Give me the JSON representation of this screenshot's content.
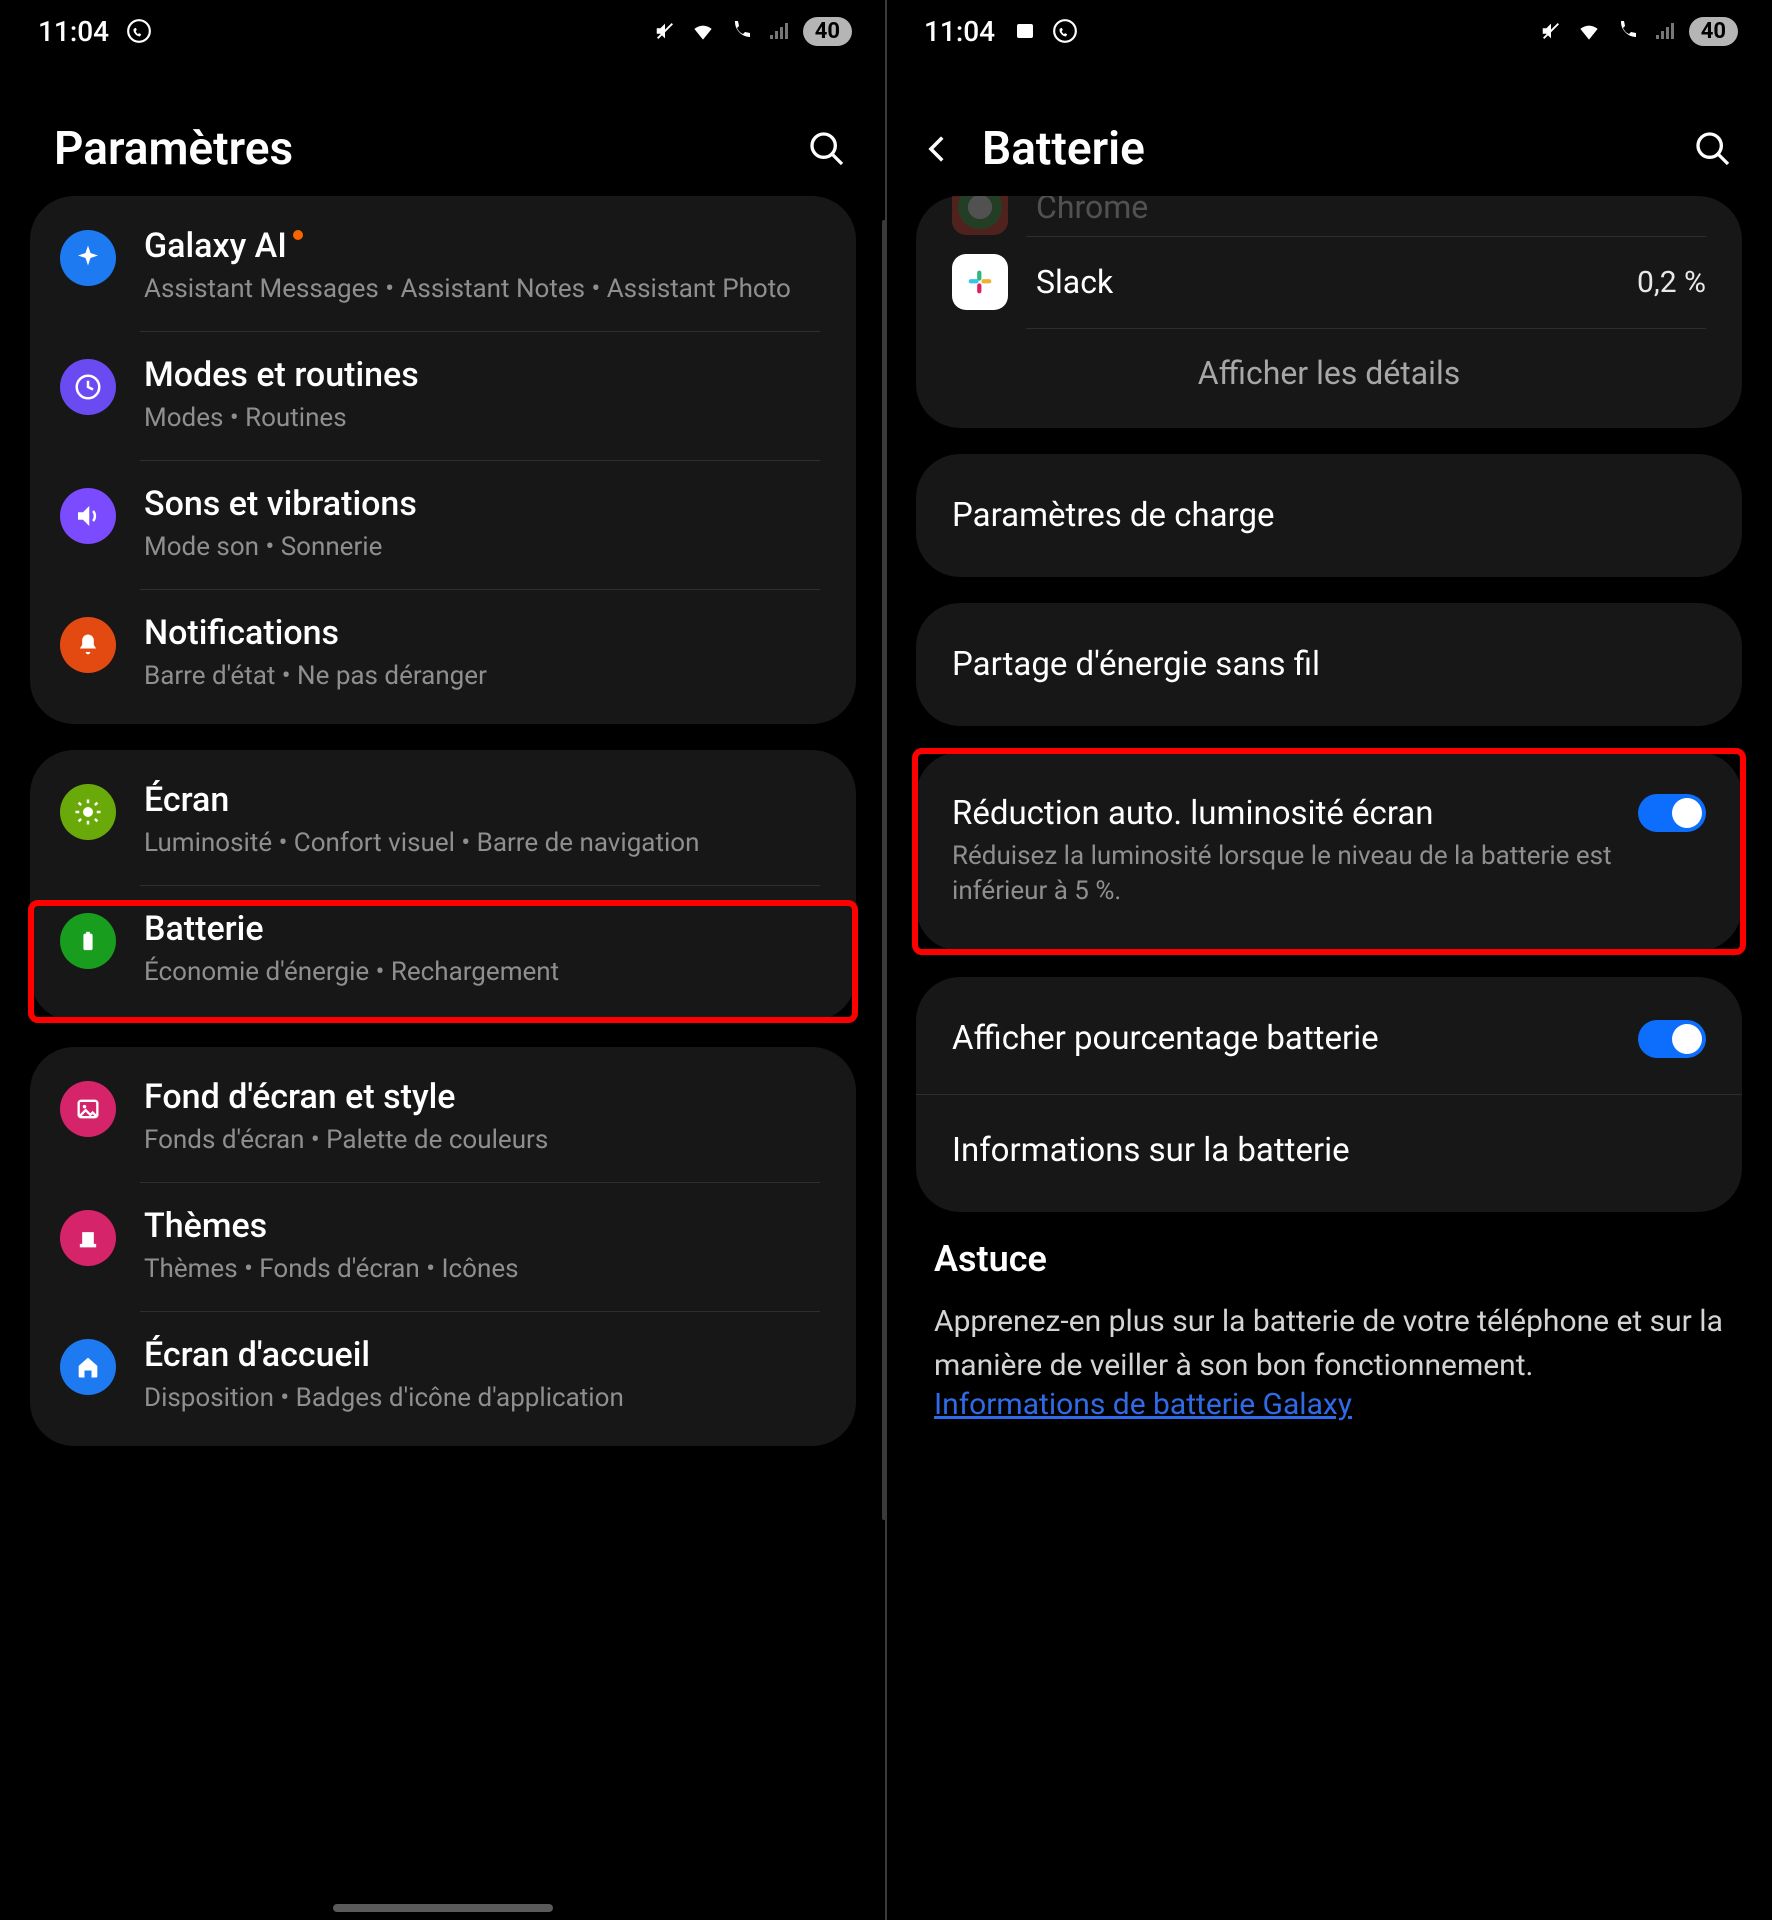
{
  "left": {
    "status": {
      "time": "11:04",
      "battery_pct": "40"
    },
    "title": "Paramètres",
    "groups": [
      {
        "items": [
          {
            "key": "galaxy-ai",
            "icon_bg": "#1d7af0",
            "title": "Galaxy AI",
            "badge": true,
            "sub": "Assistant Messages  •  Assistant Notes  • Assistant Photo"
          },
          {
            "key": "modes",
            "icon_bg": "#6a4bf2",
            "title": "Modes et routines",
            "sub": "Modes  •  Routines"
          },
          {
            "key": "sons",
            "icon_bg": "#7a4bff",
            "title": "Sons et vibrations",
            "sub": "Mode son  •  Sonnerie"
          },
          {
            "key": "notifs",
            "icon_bg": "#e24a12",
            "title": "Notifications",
            "sub": "Barre d'état  •  Ne pas déranger"
          }
        ]
      },
      {
        "items": [
          {
            "key": "ecran",
            "icon_bg": "#6aa90a",
            "title": "Écran",
            "sub": "Luminosité  •  Confort visuel  •  Barre de navigation"
          },
          {
            "key": "batterie",
            "icon_bg": "#189d1f",
            "title": "Batterie",
            "sub": "Économie d'énergie  •  Rechargement",
            "highlight": true
          }
        ]
      },
      {
        "items": [
          {
            "key": "fond",
            "icon_bg": "#d6246b",
            "title": "Fond d'écran et style",
            "sub": "Fonds d'écran  •  Palette de couleurs"
          },
          {
            "key": "themes",
            "icon_bg": "#d6246b",
            "title": "Thèmes",
            "sub": "Thèmes  •  Fonds d'écran  •  Icônes"
          },
          {
            "key": "accueil",
            "icon_bg": "#1d7af0",
            "title": "Écran d'accueil",
            "sub": "Disposition  •  Badges d'icône d'application"
          }
        ]
      }
    ]
  },
  "right": {
    "status": {
      "time": "11:04",
      "battery_pct": "40"
    },
    "title": "Batterie",
    "apps": {
      "hidden_name": "Chrome",
      "items": [
        {
          "key": "slack",
          "name": "Slack",
          "pct": "0,2 %"
        }
      ],
      "details_label": "Afficher les détails"
    },
    "settings1": [
      {
        "key": "charge",
        "title": "Paramètres de charge"
      }
    ],
    "settings2": [
      {
        "key": "wireless-share",
        "title": "Partage d'énergie sans fil"
      }
    ],
    "settings3": [
      {
        "key": "auto-dim",
        "title": "Réduction auto. luminosité écran",
        "sub": "Réduisez la luminosité lorsque le niveau de la batterie est inférieur à 5 %.",
        "toggle": true,
        "highlight": true
      }
    ],
    "settings4": [
      {
        "key": "pct-show",
        "title": "Afficher pourcentage batterie",
        "toggle": true
      },
      {
        "key": "batt-info",
        "title": "Informations sur la batterie"
      }
    ],
    "tip": {
      "heading": "Astuce",
      "body": "Apprenez-en plus sur la batterie de votre téléphone et sur la manière de veiller à son bon fonctionnement.",
      "link": "Informations de batterie Galaxy"
    }
  }
}
